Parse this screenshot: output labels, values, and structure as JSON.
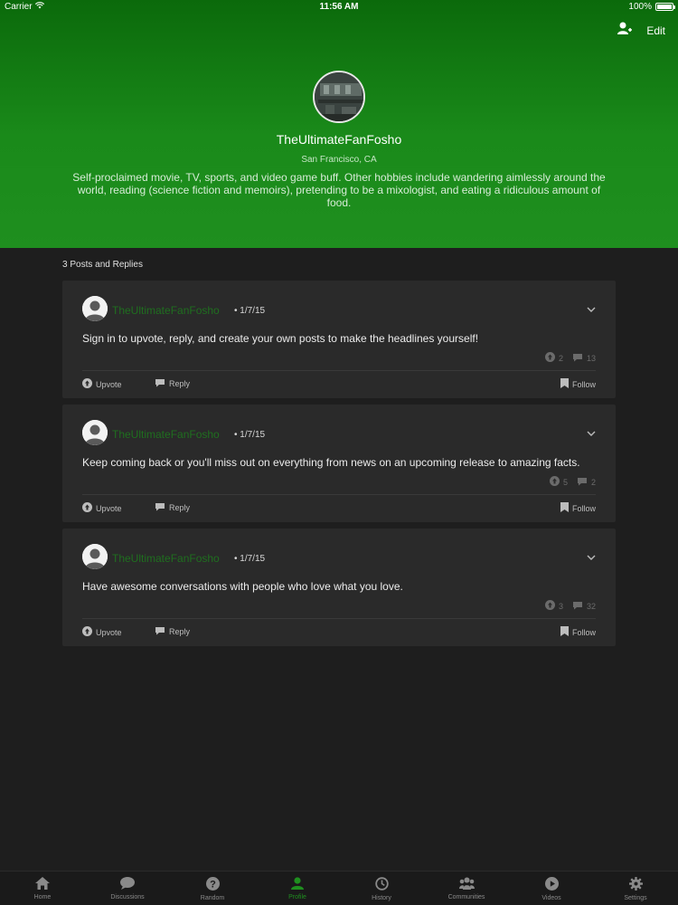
{
  "status_bar": {
    "carrier": "Carrier",
    "time": "11:56 AM",
    "battery": "100%"
  },
  "header": {
    "edit_label": "Edit",
    "username": "TheUltimateFanFosho",
    "location": "San Francisco, CA",
    "bio": "Self-proclaimed movie, TV, sports, and video game buff. Other hobbies include wandering aimlessly around the world, reading (science fiction and memoirs), pretending to be a mixologist, and eating a ridiculous amount of food.",
    "colors": {
      "gradient_top": "#0b6a0b",
      "gradient_bottom": "#1f8f1f"
    }
  },
  "section_title": "3 Posts and Replies",
  "posts": [
    {
      "author": "TheUltimateFanFosho",
      "date": "1/7/15",
      "text": "Sign in to upvote, reply, and create your own posts to make the headlines yourself!",
      "upvotes": "2",
      "comments": "13",
      "upvote_label": "Upvote",
      "reply_label": "Reply",
      "follow_label": "Follow"
    },
    {
      "author": "TheUltimateFanFosho",
      "date": "1/7/15",
      "text": "Keep coming back or you'll miss out on everything from news on an upcoming release to amazing facts.",
      "upvotes": "5",
      "comments": "2",
      "upvote_label": "Upvote",
      "reply_label": "Reply",
      "follow_label": "Follow"
    },
    {
      "author": "TheUltimateFanFosho",
      "date": "1/7/15",
      "text": "Have awesome conversations with people who love what you love.",
      "upvotes": "3",
      "comments": "32",
      "upvote_label": "Upvote",
      "reply_label": "Reply",
      "follow_label": "Follow"
    }
  ],
  "tabs": [
    {
      "label": "Home",
      "icon": "home-icon"
    },
    {
      "label": "Discussions",
      "icon": "discussions-icon"
    },
    {
      "label": "Random",
      "icon": "random-icon"
    },
    {
      "label": "Profile",
      "icon": "profile-icon",
      "active": true
    },
    {
      "label": "History",
      "icon": "history-icon"
    },
    {
      "label": "Communities",
      "icon": "communities-icon"
    },
    {
      "label": "Videos",
      "icon": "videos-icon"
    },
    {
      "label": "Settings",
      "icon": "settings-icon"
    }
  ],
  "colors": {
    "accent": "#1f8f1f",
    "background": "#1e1e1e",
    "card": "#2a2a2a"
  }
}
